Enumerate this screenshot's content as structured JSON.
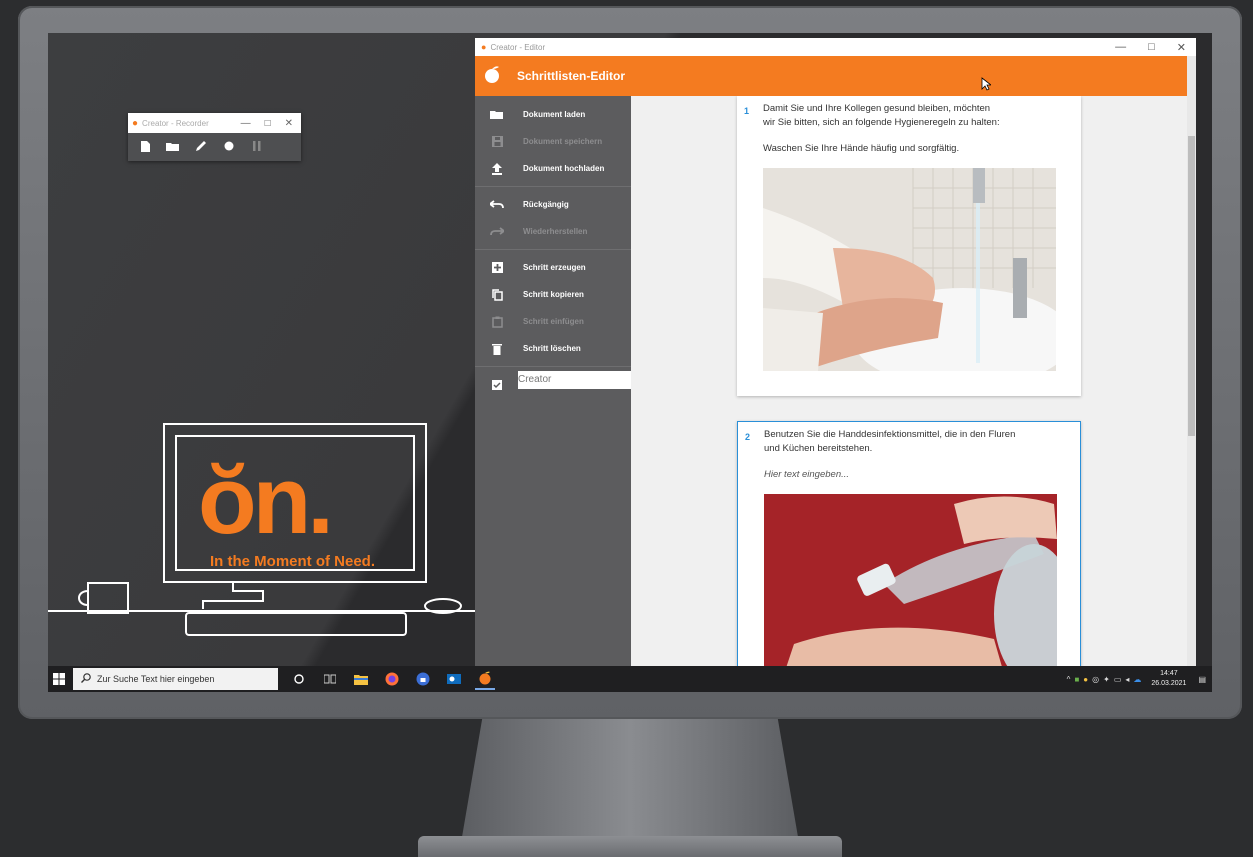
{
  "recorder": {
    "title": "Creator - Recorder",
    "controls": [
      "—",
      "□",
      "✕"
    ]
  },
  "brand": {
    "logo_text": "ŏn.",
    "tagline": "In the Moment of Need.",
    "accent": "#f47b20"
  },
  "editor": {
    "window_title": "Creator - Editor",
    "header_title": "Schrittlisten-Editor",
    "sidebar": [
      {
        "label": "Dokument laden",
        "icon": "folder-open-icon",
        "enabled": true
      },
      {
        "label": "Dokument speichern",
        "icon": "save-icon",
        "enabled": false
      },
      {
        "label": "Dokument hochladen",
        "icon": "upload-icon",
        "enabled": true
      },
      {
        "label": "Rückgängig",
        "icon": "undo-icon",
        "enabled": true
      },
      {
        "label": "Wiederherstellen",
        "icon": "redo-icon",
        "enabled": false
      },
      {
        "label": "Schritt erzeugen",
        "icon": "add-icon",
        "enabled": true
      },
      {
        "label": "Schritt kopieren",
        "icon": "copy-icon",
        "enabled": true
      },
      {
        "label": "Schritt einfügen",
        "icon": "paste-icon",
        "enabled": false
      },
      {
        "label": "Schritt löschen",
        "icon": "delete-icon",
        "enabled": true
      }
    ],
    "creator_field": "Creator",
    "steps": [
      {
        "number": "1",
        "text_line1": "Damit Sie und Ihre Kollegen gesund bleiben, möchten",
        "text_line2": "wir Sie bitten, sich an folgende Hygieneregeln zu halten:",
        "text_line3": "Waschen Sie Ihre Hände häufig und sorgfältig.",
        "image": "handwashing-photo"
      },
      {
        "number": "2",
        "text_line1": "Benutzen Sie die Handdesinfektionsmittel, die in den Fluren",
        "text_line2": "und Küchen bereitstehen.",
        "placeholder": "Hier text eingeben...",
        "image": "sanitizer-photo"
      }
    ]
  },
  "taskbar": {
    "search_placeholder": "Zur Suche Text hier eingeben",
    "time": "14:47",
    "date": "26.03.2021"
  }
}
